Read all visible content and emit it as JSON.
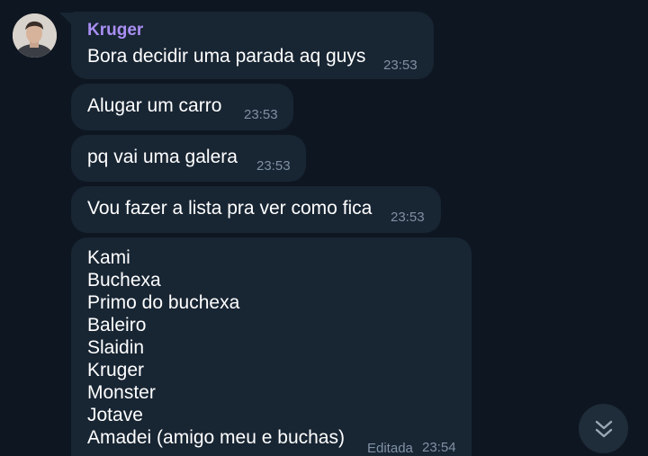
{
  "messages": [
    {
      "sender": "Kruger",
      "text": "Bora decidir uma parada aq guys",
      "time": "23:53"
    },
    {
      "text": "Alugar um carro",
      "time": "23:53"
    },
    {
      "text": "pq vai uma galera",
      "time": "23:53"
    },
    {
      "text": "Vou fazer a lista pra ver como fica",
      "time": "23:53"
    }
  ],
  "list_message": {
    "lines": [
      "Kami",
      "Buchexa",
      "Primo do buchexa",
      "Baleiro",
      "Slaidin",
      "Kruger",
      "Monster",
      "Jotave",
      "Amadei (amigo meu e buchas)"
    ],
    "edited_label": "Editada",
    "time": "23:54"
  },
  "icons": {
    "avatar": "user-avatar",
    "scroll_down": "double-chevron-down-icon"
  },
  "colors": {
    "background": "#0e1621",
    "bubble": "#182533",
    "sender_name": "#a98ff2",
    "timestamp": "#7f91a4"
  }
}
